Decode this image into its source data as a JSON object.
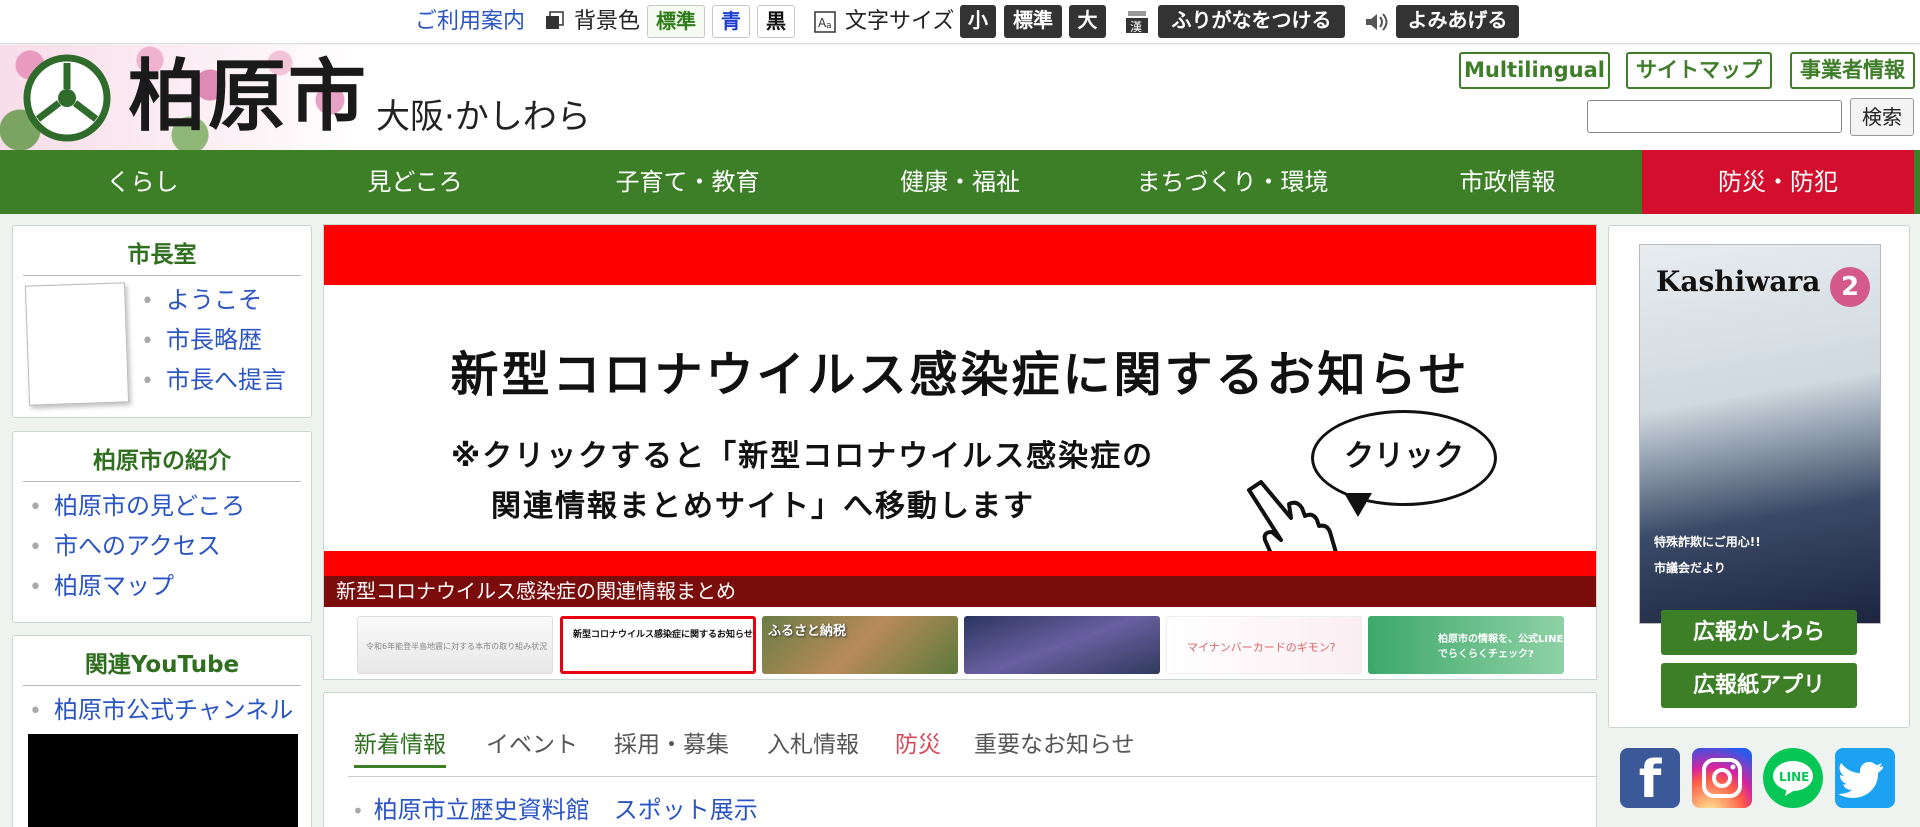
{
  "utility": {
    "guide": "ご利用案内",
    "bg_label": "背景色",
    "bg_standard": "標準",
    "bg_blue": "青",
    "bg_black": "黒",
    "size_label": "文字サイズ",
    "size_small": "小",
    "size_standard": "標準",
    "size_large": "大",
    "furigana": "ふりがなをつける",
    "read_aloud": "よみあげる"
  },
  "header": {
    "title": "柏原市",
    "subtitle": "大阪·かしわら",
    "multilingual": "Multilingual",
    "sitemap": "サイトマップ",
    "business": "事業者情報",
    "search_button": "検索",
    "search_value": ""
  },
  "nav": [
    "くらし",
    "見どころ",
    "子育て・教育",
    "健康・福祉",
    "まちづくり・環境",
    "市政情報",
    "防災・防犯"
  ],
  "sidebar": {
    "mayor": {
      "title": "市長室",
      "items": [
        "ようこそ",
        "市長略歴",
        "市長へ提言"
      ]
    },
    "intro": {
      "title": "柏原市の紹介",
      "items": [
        "柏原市の見どころ",
        "市へのアクセス",
        "柏原マップ"
      ]
    },
    "youtube": {
      "title": "関連YouTube",
      "items": [
        "柏原市公式チャンネル"
      ]
    }
  },
  "banner": {
    "heading": "新型コロナウイルス感染症に関するお知らせ",
    "line1": "※クリックすると「新型コロナウイルス感染症の",
    "line2": "関連情報まとめサイト」へ移動します",
    "bubble": "クリック",
    "caption": "新型コロナウイルス感染症の関連情報まとめ",
    "thumb1": "令和6年能登半島地震に対する本市の取り組み状況",
    "thumb2": "新型コロナウイルス感染症に関するお知らせ",
    "thumb3": "ふるさと納税",
    "thumb5": "マイナンバーカードのギモン?",
    "thumb6": "柏原市の情報を、公式LINEでらくらくチェック?"
  },
  "news": {
    "tabs": [
      "新着情報",
      "イベント",
      "採用・募集",
      "入札情報",
      "防災",
      "重要なお知らせ"
    ],
    "items": [
      "柏原市立歴史資料館　スポット展示"
    ]
  },
  "right": {
    "cover_brand": "Kashiwara",
    "cover_issue": "2",
    "cover_feature": "特殊詐欺にご用心!!",
    "cover_sub": "市議会だより",
    "btn_pr": "広報かしわら",
    "btn_app": "広報紙アプリ"
  },
  "colors": {
    "nav_green": "#3d7f27",
    "disaster_red": "#d40f2d",
    "link_blue": "#2c55c4"
  }
}
